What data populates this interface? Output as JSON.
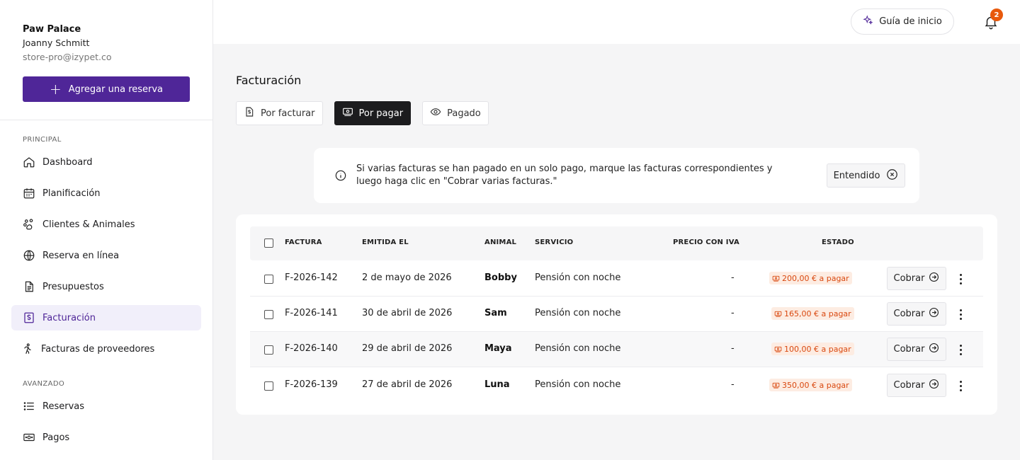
{
  "sidebar": {
    "store_name": "Paw Palace",
    "user_name": "Joanny Schmitt",
    "email": "store-pro@izypet.co",
    "add_button": "Agregar una reserva",
    "section_principal": "PRINCIPAL",
    "section_avanzado": "AVANZADO",
    "items": [
      {
        "label": "Dashboard",
        "icon": "home-icon"
      },
      {
        "label": "Planificación",
        "icon": "calendar-icon"
      },
      {
        "label": "Clientes & Animales",
        "icon": "paw-icon"
      },
      {
        "label": "Reserva en línea",
        "icon": "globe-icon"
      },
      {
        "label": "Presupuestos",
        "icon": "document-icon"
      },
      {
        "label": "Facturación",
        "icon": "invoice-icon",
        "active": true
      },
      {
        "label": "Facturas de proveedores",
        "icon": "supplier-icon"
      }
    ],
    "advanced_items": [
      {
        "label": "Reservas",
        "icon": "list-icon"
      },
      {
        "label": "Pagos",
        "icon": "money-icon"
      }
    ]
  },
  "topbar": {
    "guide_label": "Guía de inicio",
    "notification_count": "2"
  },
  "main": {
    "title": "Facturación",
    "tabs": [
      {
        "label": "Por facturar",
        "icon": "invoice-icon"
      },
      {
        "label": "Por pagar",
        "icon": "money-icon",
        "active": true
      },
      {
        "label": "Pagado",
        "icon": "eye-icon"
      }
    ],
    "info": {
      "text": "Si varias facturas se han pagado en un solo pago, marque las facturas correspondientes y luego haga clic en \"Cobrar varias facturas.\"",
      "button": "Entendido"
    },
    "table": {
      "headers": {
        "invoice": "FACTURA",
        "issued": "EMITIDA EL",
        "animal": "ANIMAL",
        "service": "SERVICIO",
        "price": "PRECIO CON IVA",
        "status": "ESTADO"
      },
      "rows": [
        {
          "invoice": "F-2026-142",
          "issued": "2 de mayo de 2026",
          "animal": "Bobby",
          "service": "Pensión con noche",
          "price": "-",
          "status": "200,00 € a pagar",
          "action": "Cobrar"
        },
        {
          "invoice": "F-2026-141",
          "issued": "30 de abril de 2026",
          "animal": "Sam",
          "service": "Pensión con noche",
          "price": "-",
          "status": "165,00 € a pagar",
          "action": "Cobrar"
        },
        {
          "invoice": "F-2026-140",
          "issued": "29 de abril de 2026",
          "animal": "Maya",
          "service": "Pensión con noche",
          "price": "-",
          "status": "100,00 € a pagar",
          "action": "Cobrar"
        },
        {
          "invoice": "F-2026-139",
          "issued": "27 de abril de 2026",
          "animal": "Luna",
          "service": "Pensión con noche",
          "price": "-",
          "status": "350,00 € a pagar",
          "action": "Cobrar"
        }
      ]
    }
  },
  "colors": {
    "brand": "#4f2698",
    "active_nav_bg": "#f1effa",
    "status_text": "#d9480f",
    "status_bg": "#fdece2",
    "badge": "#e8590c"
  }
}
